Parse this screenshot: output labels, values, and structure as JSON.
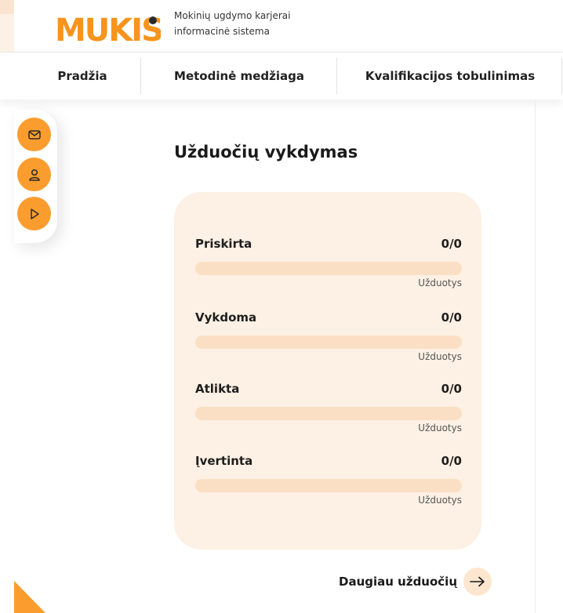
{
  "brand": {
    "logo_text": "MUKIS",
    "tagline_line1": "Mokinių ugdymo karjerai",
    "tagline_line2": "informacinė sistema",
    "accent_color": "#fb9d2e",
    "logo_color": "#f7941d"
  },
  "nav": {
    "items": [
      {
        "label": "Pradžia"
      },
      {
        "label": "Metodinė medžiaga"
      },
      {
        "label": "Kvalifikacijos tobulinimas"
      }
    ]
  },
  "sidebar_actions": [
    {
      "icon": "mail-icon"
    },
    {
      "icon": "user-icon"
    },
    {
      "icon": "play-icon"
    }
  ],
  "tasks": {
    "title": "Užduočių vykdymas",
    "rows": [
      {
        "label": "Priskirta",
        "count": "0/0",
        "unit": "Užduotys",
        "progress": 0
      },
      {
        "label": "Vykdoma",
        "count": "0/0",
        "unit": "Užduotys",
        "progress": 0
      },
      {
        "label": "Atlikta",
        "count": "0/0",
        "unit": "Užduotys",
        "progress": 0
      },
      {
        "label": "Įvertinta",
        "count": "0/0",
        "unit": "Užduotys",
        "progress": 0
      }
    ],
    "more_label": "Daugiau užduočių"
  }
}
